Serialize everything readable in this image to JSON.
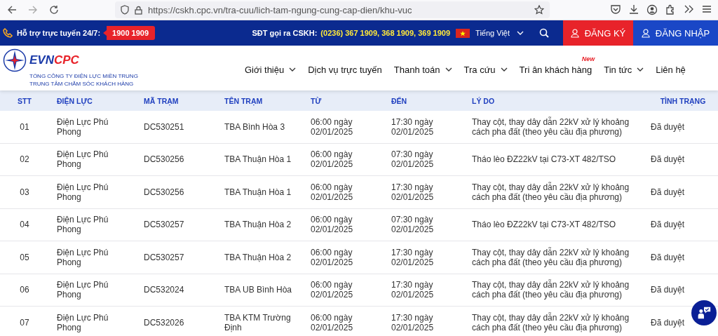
{
  "browser": {
    "url": "https://cskh.cpc.vn/tra-cuu/lich-tam-ngung-cung-cap-dien/khu-vuc"
  },
  "topbar": {
    "support_label": "Hỗ trợ trực tuyến 24/7:",
    "support_phone": "1900 1909",
    "cskh_label": "SĐT gọi ra CSKH:",
    "cskh_phones": "(0236) 367 1909, 368 1909, 369 1909",
    "language": "Tiếng Việt",
    "register": "ĐĂNG KÝ",
    "login": "ĐĂNG NHẬP"
  },
  "header": {
    "logo_main": "EVN",
    "logo_accent": "CPC",
    "company": "TỔNG CÔNG TY ĐIỆN LỰC MIỀN TRUNG",
    "center": "TRUNG TÂM CHĂM SÓC KHÁCH HÀNG",
    "nav": [
      {
        "label": "Giới thiệu",
        "dropdown": true
      },
      {
        "label": "Dịch vụ trực tuyến",
        "dropdown": false
      },
      {
        "label": "Thanh toán",
        "dropdown": true
      },
      {
        "label": "Tra cứu",
        "dropdown": true
      },
      {
        "label": "Tri ân khách hàng",
        "dropdown": false,
        "badge": "New"
      },
      {
        "label": "Tin tức",
        "dropdown": true
      },
      {
        "label": "Liên hệ",
        "dropdown": false
      }
    ]
  },
  "table": {
    "columns": [
      "STT",
      "ĐIỆN LỰC",
      "MÃ TRẠM",
      "TÊN TRẠM",
      "TỪ",
      "ĐẾN",
      "LÝ DO",
      "TÌNH TRẠNG"
    ],
    "rows": [
      [
        "01",
        "Điện Lực Phú Phong",
        "DC530251",
        "TBA Bình Hòa 3",
        "06:00 ngày 02/01/2025",
        "17:30 ngày 02/01/2025",
        "Thay cột, thay dây dẫn 22kV xử lý khoảng cách pha đất (theo yêu cầu địa phương)",
        "Đã duyệt"
      ],
      [
        "02",
        "Điện Lực Phú Phong",
        "DC530256",
        "TBA Thuận Hòa 1",
        "06:00 ngày 02/01/2025",
        "07:30 ngày 02/01/2025",
        "Tháo lèo ĐZ22kV tại C73-XT 482/TSO",
        "Đã duyệt"
      ],
      [
        "03",
        "Điện Lực Phú Phong",
        "DC530256",
        "TBA Thuận Hòa 1",
        "06:00 ngày 02/01/2025",
        "17:30 ngày 02/01/2025",
        "Thay cột, thay dây dẫn 22kV xử lý khoảng cách pha đất (theo yêu cầu địa phương)",
        "Đã duyệt"
      ],
      [
        "04",
        "Điện Lực Phú Phong",
        "DC530257",
        "TBA Thuận Hòa 2",
        "06:00 ngày 02/01/2025",
        "07:30 ngày 02/01/2025",
        "Tháo lèo ĐZ22kV tại C73-XT 482/TSO",
        "Đã duyệt"
      ],
      [
        "05",
        "Điện Lực Phú Phong",
        "DC530257",
        "TBA Thuận Hòa 2",
        "06:00 ngày 02/01/2025",
        "17:30 ngày 02/01/2025",
        "Thay cột, thay dây dẫn 22kV xử lý khoảng cách pha đất (theo yêu cầu địa phương)",
        "Đã duyệt"
      ],
      [
        "06",
        "Điện Lực Phú Phong",
        "DC532024",
        "TBA UB Bình Hòa",
        "06:00 ngày 02/01/2025",
        "17:30 ngày 02/01/2025",
        "Thay cột, thay dây dẫn 22kV xử lý khoảng cách pha đất (theo yêu cầu địa phương)",
        "Đã duyệt"
      ],
      [
        "07",
        "Điện Lực Phú Phong",
        "DC532026",
        "TBA KTM Trường Định",
        "06:00 ngày 02/01/2025",
        "17:30 ngày 02/01/2025",
        "Thay cột, thay dây dẫn 22kV xử lý khoảng cách pha đất (theo yêu cầu địa phương)",
        "Đã duyệt"
      ]
    ]
  }
}
